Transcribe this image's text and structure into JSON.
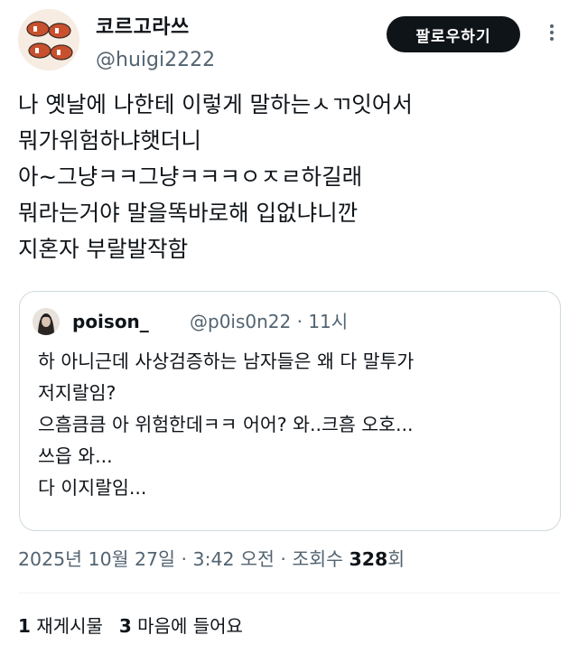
{
  "author": {
    "display_name": "코르고라쓰",
    "handle": "@huigi2222"
  },
  "follow_button_label": "팔로우하기",
  "tweet_lines": [
    "나 옛날에 나한테 이렇게 말하는ㅅㄲ잇어서",
    "뭐가위험하냐햇더니",
    "아~그냥ㅋㅋ그냥ㅋㅋㅋㅇㅈㄹ하길래",
    "뭐라는거야 말을똑바로해 입없냐니깐",
    "지혼자 부랄발작함"
  ],
  "quoted": {
    "name": "poison_",
    "handle": "@p0is0n22",
    "separator": "·",
    "time": "11시",
    "lines": [
      "하 아니근데 사상검증하는 남자들은 왜 다 말투가",
      "저지랄임?",
      "으흠큼큼 아 위험한데ㅋㅋ 어어? 와..크흠 오호...",
      "쓰읍 와...",
      "다 이지랄임..."
    ]
  },
  "timestamp": {
    "date": "2025년 10월 27일",
    "sep1": " · ",
    "time": "3:42 오전",
    "sep2": " · ",
    "views_label": "조회수 ",
    "views_count": "328",
    "views_unit": "회"
  },
  "stats": {
    "reposts_count": "1",
    "reposts_label": " 재게시물",
    "likes_count": "3",
    "likes_label": " 마음에 들어요"
  }
}
